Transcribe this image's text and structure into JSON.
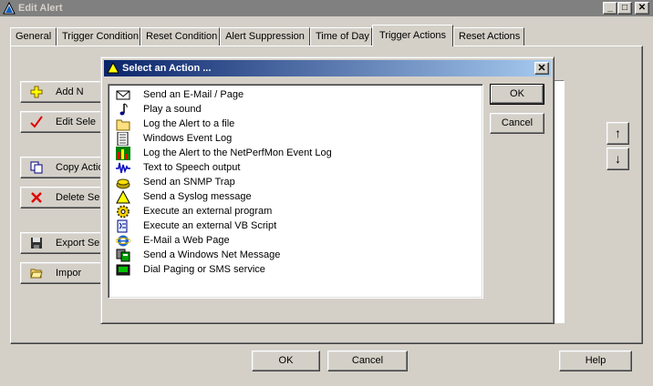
{
  "window": {
    "title": "Edit Alert",
    "min": "_",
    "max": "□",
    "close": "✕"
  },
  "tabs": [
    {
      "label": "General"
    },
    {
      "label": "Trigger Condition"
    },
    {
      "label": "Reset Condition"
    },
    {
      "label": "Alert Suppression"
    },
    {
      "label": "Time of Day"
    },
    {
      "label": "Trigger Actions"
    },
    {
      "label": "Reset Actions"
    }
  ],
  "side_buttons": [
    {
      "label": "Add N",
      "icon": "plus-icon"
    },
    {
      "label": "Edit Sele",
      "icon": "check-icon"
    },
    {
      "label": "Copy Actio",
      "icon": "copy-icon"
    },
    {
      "label": "Delete Sele",
      "icon": "delete-x-icon"
    },
    {
      "label": "Export Sel",
      "icon": "save-disk-icon"
    },
    {
      "label": "Impor",
      "icon": "open-folder-icon"
    }
  ],
  "arrows": {
    "up": "↑",
    "down": "↓"
  },
  "bottom": {
    "ok": "OK",
    "cancel": "Cancel",
    "help": "Help"
  },
  "dialog": {
    "title": "Select an Action ...",
    "close": "✕",
    "ok": "OK",
    "cancel": "Cancel",
    "actions": [
      {
        "label": "Send an E-Mail / Page",
        "icon": "envelope-icon"
      },
      {
        "label": "Play a sound",
        "icon": "music-note-icon"
      },
      {
        "label": "Log the Alert to a file",
        "icon": "folder-icon"
      },
      {
        "label": "Windows Event Log",
        "icon": "event-log-icon"
      },
      {
        "label": "Log the Alert to the NetPerfMon Event Log",
        "icon": "bar-chart-icon"
      },
      {
        "label": "Text to Speech output",
        "icon": "waveform-icon"
      },
      {
        "label": "Send an SNMP Trap",
        "icon": "trap-icon"
      },
      {
        "label": "Send a Syslog message",
        "icon": "warning-icon"
      },
      {
        "label": "Execute an external program",
        "icon": "gear-icon"
      },
      {
        "label": "Execute an external VB Script",
        "icon": "script-icon"
      },
      {
        "label": "E-Mail a Web Page",
        "icon": "internet-explorer-icon"
      },
      {
        "label": "Send a Windows Net Message",
        "icon": "net-message-icon"
      },
      {
        "label": "Dial Paging or SMS service",
        "icon": "pager-icon"
      }
    ]
  },
  "colors": {
    "face": "#d4d0c8",
    "title_active": "#0a246a",
    "title_inactive": "#808080"
  }
}
